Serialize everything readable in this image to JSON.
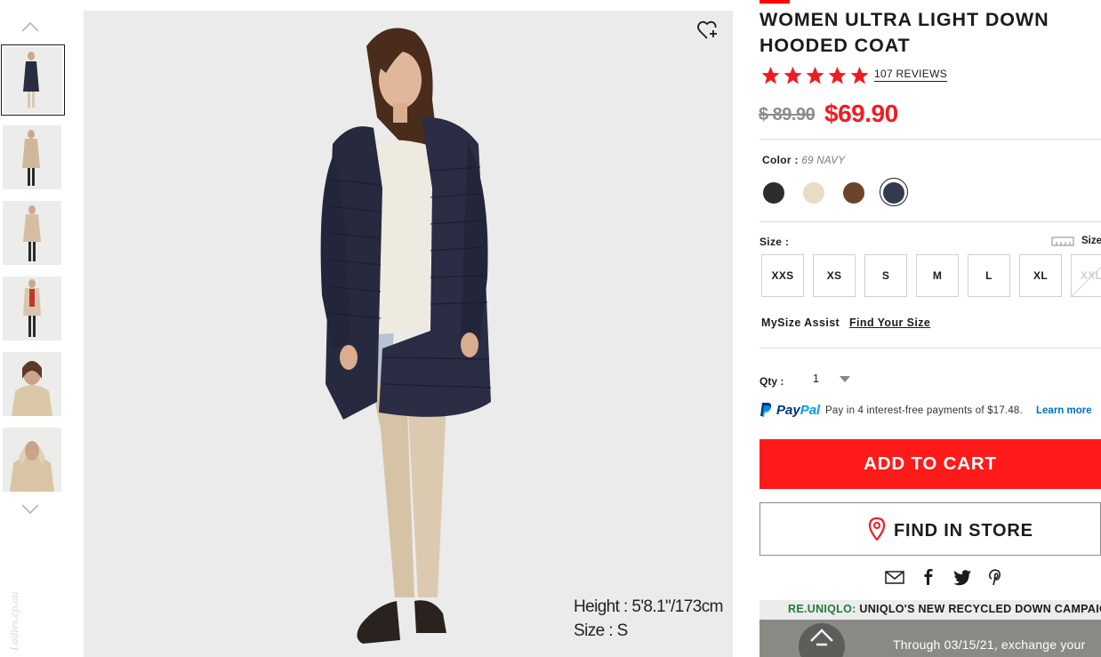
{
  "product": {
    "title": "WOMEN ULTRA LIGHT DOWN HOODED COAT",
    "rating": 5,
    "reviews_label": "107 REVIEWS",
    "old_price": "$ 89.90",
    "new_price": "$69.90"
  },
  "image": {
    "caption_height": "Height : 5'8.1\"/173cm",
    "caption_size": "Size : S"
  },
  "watermark": "Ladies.ep.au",
  "color": {
    "label": "Color :",
    "selected_value": "69 NAVY",
    "swatches": [
      "#2d2d2d",
      "#e8dcc6",
      "#6b4429",
      "#363a4f"
    ]
  },
  "size": {
    "label": "Size :",
    "chart_label": "Size",
    "options": [
      "XXS",
      "XS",
      "S",
      "M",
      "L",
      "XL",
      "XXL"
    ],
    "unavailable": [
      "XXL"
    ],
    "mysize_label": "MySize Assist",
    "find_size": "Find Your Size"
  },
  "qty": {
    "label": "Qty :",
    "value": "1"
  },
  "paypal": {
    "logo_pay": "Pay",
    "logo_pal": "Pal",
    "text": "Pay in 4 interest-free payments of $17.48.",
    "learn_more": "Learn more"
  },
  "actions": {
    "add_to_cart": "ADD TO CART",
    "find_in_store": "FIND IN STORE"
  },
  "banner": {
    "brand": "RE.UNIQLO:",
    "title": "UNIQLO'S NEW RECYCLED DOWN CAMPAIGN",
    "text": "Through 03/15/21, exchange your"
  },
  "colors": {
    "accent_red": "#ff1a1a",
    "price_red": "#ef1c24",
    "paypal_blue": "#0070ba",
    "paypal_dark": "#003087"
  }
}
